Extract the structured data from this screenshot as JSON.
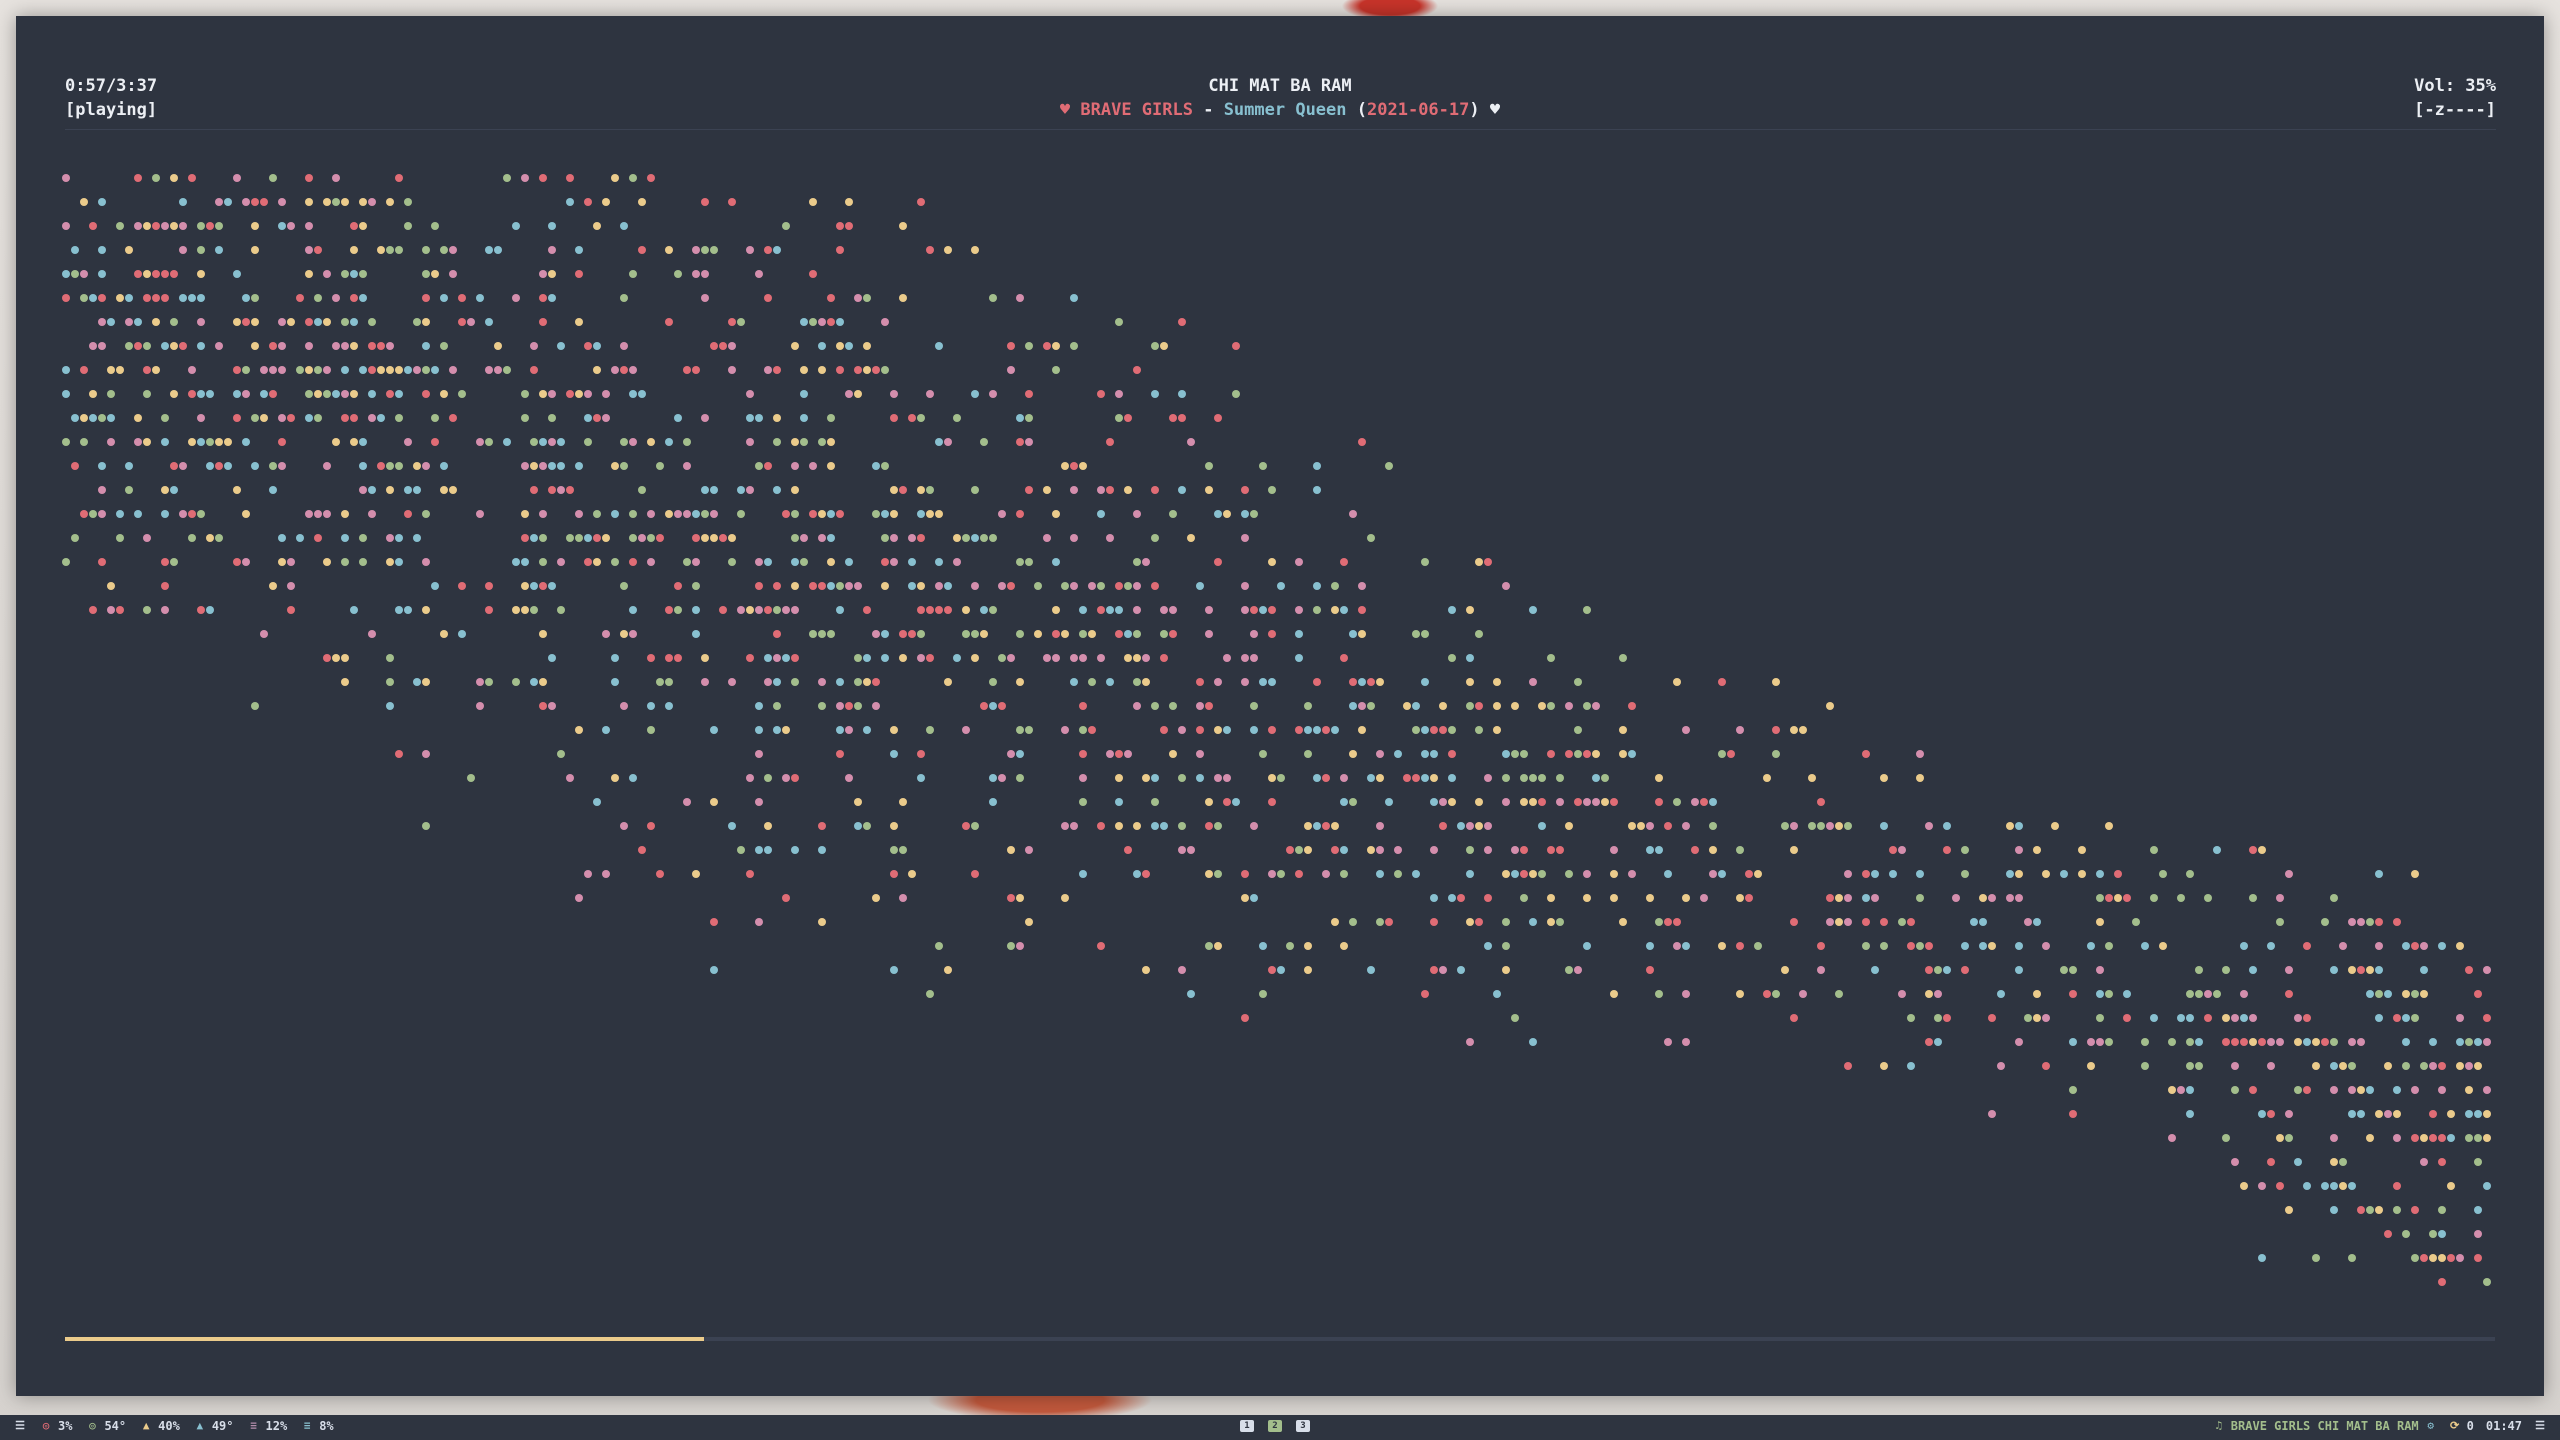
{
  "player": {
    "time": "0:57/3:37",
    "state": "[playing]",
    "title": "CHI MAT BA RAM",
    "artist": "BRAVE GIRLS",
    "separator": " - ",
    "album": "Summer Queen",
    "date_open": "(",
    "date": "2021-06-17",
    "date_close": ")",
    "volume": "Vol: 35%",
    "mode": "[-z----]",
    "heart_icon": "heart-icon",
    "progress": 0.263
  },
  "colors": {
    "background": "#2e3440",
    "accent_red": "#e06c75",
    "accent_blue": "#88c0d0",
    "accent_yellow": "#ebcb8b",
    "accent_green": "#a3be8c",
    "accent_purple": "#d48ead",
    "progress": "#ebcb8b"
  },
  "statusbar": {
    "menu_icon": "menu-icon",
    "cpu": "3%",
    "temp": "54°",
    "memory": "40%",
    "gpu_temp": "49°",
    "disk1": "12%",
    "disk2": "8%",
    "workspaces": [
      "1",
      "2",
      "3"
    ],
    "now_playing": "BRAVE GIRLS CHI MAT BA RAM",
    "updates": "0",
    "clock": "01:47",
    "tray_icon": "tray-menu-icon"
  }
}
